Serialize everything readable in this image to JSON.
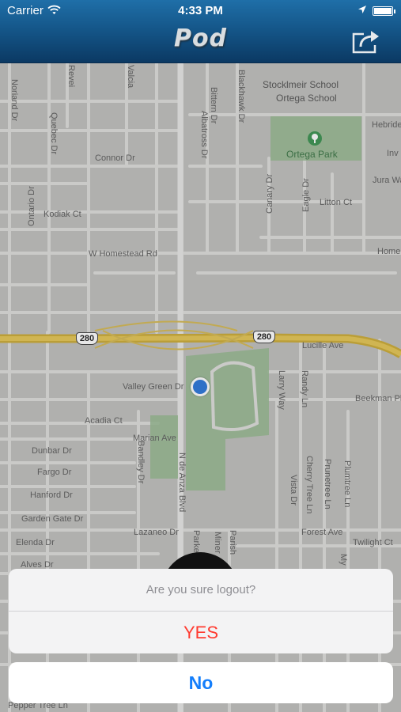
{
  "status_bar": {
    "carrier": "Carrier",
    "time": "4:33 PM"
  },
  "header": {
    "title": "Pod",
    "share_icon": "share-icon"
  },
  "map": {
    "schools": [
      "Stocklmeir School",
      "Ortega School"
    ],
    "park": "Ortega Park",
    "streets": {
      "noriand": "Noriand Dr",
      "reveille": "Revei",
      "valcia": "Valcia",
      "quebec": "Quebec Dr",
      "connor": "Connor Dr",
      "albatross": "Albatross Dr",
      "bittern": "Bittern Dr",
      "blackhawk": "Blackhawk Dr",
      "hebride": "Hebride",
      "inv": "Inv",
      "jura": "Jura Wa",
      "ontario": "Ontario Dr",
      "kodiak": "Kodiak Ct",
      "canary": "Canary Dr",
      "eagle": "Eagle Dr",
      "litton": "Litton Ct",
      "homestead": "W Homestead Rd",
      "home": "Home",
      "lucille": "Lucille Ave",
      "valley_green": "Valley Green Dr",
      "acadia": "Acadia Ct",
      "larry": "Larry Way",
      "randy": "Randy Ln",
      "beekman": "Beekman Pl",
      "marian": "Marian Ave",
      "dunbar": "Dunbar Dr",
      "fargo": "Fargo Dr",
      "hanford": "Hanford Dr",
      "garden_gate": "Garden Gate Dr",
      "elenda": "Elenda Dr",
      "alves": "Alves Dr",
      "bandley": "Bandley Dr",
      "de_anza": "N de Anza Blvd",
      "lazaneo": "Lazaneo Dr",
      "cherry_tree": "Cherry Tree Ln",
      "vista": "Vista Dr",
      "prunetree": "Prunetree Ln",
      "plumtree": "Plumtree Ln",
      "forest": "Forest Ave",
      "twilight": "Twilight Ct",
      "parker": "Parker",
      "miner": "Miner",
      "parish": "Parish",
      "my": "My",
      "pepper_tree": "Pepper Tree Ln"
    },
    "highway_shield": "280"
  },
  "action_sheet": {
    "title": "Are you sure logout?",
    "confirm_label": "YES",
    "cancel_label": "No",
    "confirm_color": "#ff3b30",
    "cancel_color": "#147efb"
  }
}
